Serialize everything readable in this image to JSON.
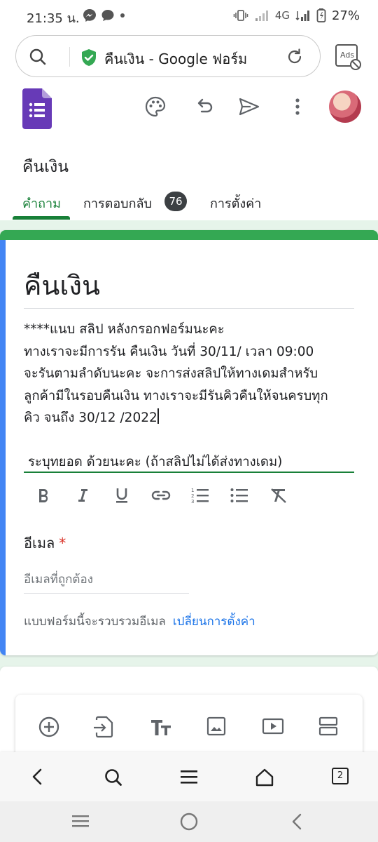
{
  "status_bar": {
    "time": "21:35 น.",
    "network": "4G",
    "battery": "27%",
    "icons": [
      "messenger-icon",
      "chat-icon",
      "dot-icon",
      "vibrate-icon",
      "signal-icon",
      "battery-icon"
    ]
  },
  "browser": {
    "url_title": "คืนเงิน - Google ฟอร์ม",
    "ads_label": "Ads",
    "tab_count": "2"
  },
  "app": {
    "form_name": "คืนเงิน",
    "tabs": [
      {
        "label": "คำถาม",
        "active": true
      },
      {
        "label": "การตอบกลับ",
        "badge": "76"
      },
      {
        "label": "การตั้งค่า"
      }
    ]
  },
  "header_card": {
    "title": "คืนเงิน",
    "description_lines": [
      "****แนบ สลิป หลังกรอกฟอร์มนะคะ",
      "ทางเราจะมีการรัน คืนเงิน วันที่ 30/11/ เวลา 09:00",
      "จะรันตามลำดับนะคะ จะการส่งสลิปให้ทางเดมสำหรับ",
      "ลูกค้ามีในรอบคืนเงิน ทางเราจะมีรันคิวคืนให้จนครบทุก",
      "คิว จนถึง 30/12 /2022"
    ],
    "edit_line": "ระบุทยอด ด้วยนะคะ (ถ้าสลิปไม่ได้ส่งทางเดม)",
    "format_buttons": [
      "bold",
      "italic",
      "underline",
      "link",
      "numbered-list",
      "bulleted-list",
      "clear-format"
    ],
    "email_label": "อีเมล",
    "required_mark": "*",
    "email_placeholder": "อีเมลที่ถูกต้อง",
    "collect_note": "แบบฟอร์มนี้จะรวบรวมอีเมล",
    "collect_link": "เปลี่ยนการตั้งค่า"
  },
  "colors": {
    "accent_green": "#188038",
    "header_green": "#34a853",
    "left_blue": "#4285f4",
    "background_tint": "#e6f4ea",
    "link_blue": "#1a73e8",
    "logo_purple": "#673ab7"
  }
}
